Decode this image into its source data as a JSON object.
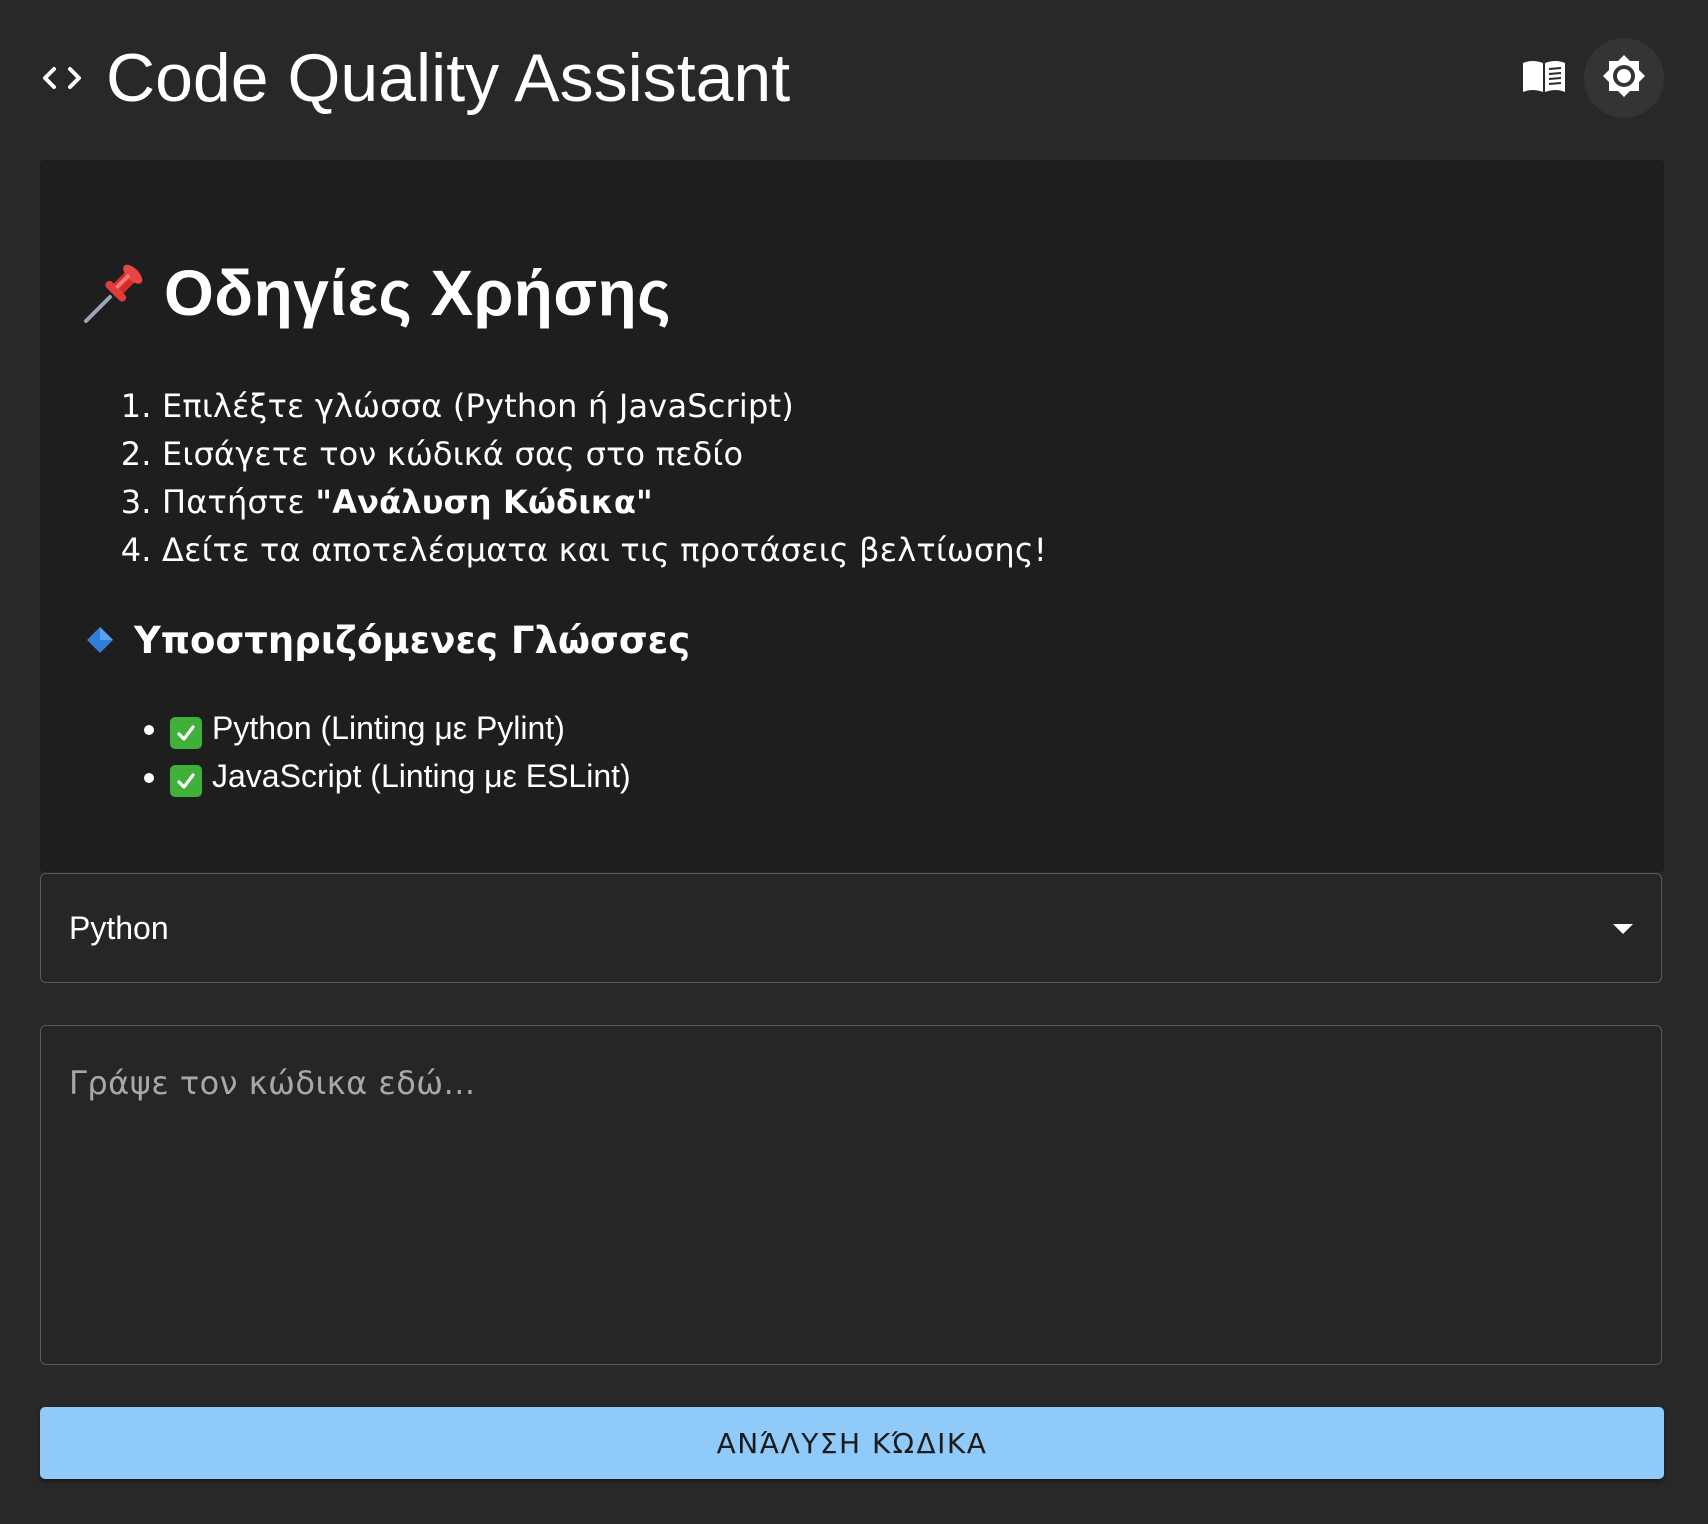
{
  "header": {
    "title": "Code Quality Assistant",
    "code_icon": "code-brackets-icon",
    "docs_icon": "book-icon",
    "theme_icon": "brightness-icon"
  },
  "instructions": {
    "title": "Οδηγίες Χρήσης",
    "title_icon": "pushpin-icon",
    "steps": [
      {
        "text": "Επιλέξτε γλώσσα (Python ή JavaScript)"
      },
      {
        "text": "Εισάγετε τον κώδικά σας στο πεδίο"
      },
      {
        "prefix": "Πατήστε ",
        "bold": "\"Ανάλυση Κώδικα\""
      },
      {
        "text": "Δείτε τα αποτελέσματα και τις προτάσεις βελτίωσης!"
      }
    ],
    "supported_title": "Υποστηριζόμενες Γλώσσες",
    "supported_icon": "blue-diamond-icon",
    "languages": [
      "Python (Linting με Pylint)",
      "JavaScript (Linting με ESLint)"
    ]
  },
  "language_select": {
    "value": "Python"
  },
  "code_input": {
    "placeholder": "Γράψε τον κώδικα εδώ..."
  },
  "analyze_button": {
    "label": "ΑΝΆΛΥΣΗ ΚΏΔΙΚΑ"
  },
  "colors": {
    "background": "#282828",
    "panel": "#1e1e1e",
    "accent": "#90caf9",
    "check": "#3fb13b"
  }
}
